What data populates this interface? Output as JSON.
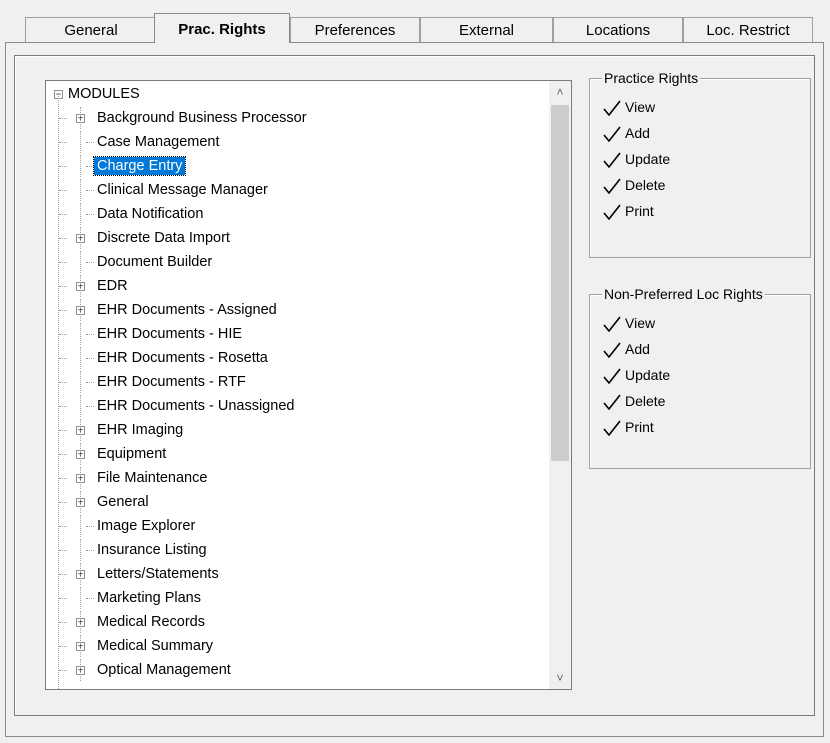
{
  "tabs": [
    {
      "label": "General",
      "active": false
    },
    {
      "label": "Prac. Rights",
      "active": true
    },
    {
      "label": "Preferences",
      "active": false
    },
    {
      "label": "External",
      "active": false
    },
    {
      "label": "Locations",
      "active": false
    },
    {
      "label": "Loc. Restrict",
      "active": false
    }
  ],
  "tree": {
    "root": "MODULES",
    "selected": "Charge Entry",
    "items": [
      {
        "label": "Background Business Processor",
        "expandable": true
      },
      {
        "label": "Case Management",
        "expandable": false
      },
      {
        "label": "Charge Entry",
        "expandable": false
      },
      {
        "label": "Clinical Message Manager",
        "expandable": false
      },
      {
        "label": "Data Notification",
        "expandable": false
      },
      {
        "label": "Discrete Data Import",
        "expandable": true
      },
      {
        "label": "Document Builder",
        "expandable": false
      },
      {
        "label": "EDR",
        "expandable": true
      },
      {
        "label": "EHR Documents - Assigned",
        "expandable": true
      },
      {
        "label": "EHR Documents - HIE",
        "expandable": false
      },
      {
        "label": "EHR Documents - Rosetta",
        "expandable": false
      },
      {
        "label": "EHR Documents - RTF",
        "expandable": false
      },
      {
        "label": "EHR Documents - Unassigned",
        "expandable": false
      },
      {
        "label": "EHR Imaging",
        "expandable": true
      },
      {
        "label": "Equipment",
        "expandable": true
      },
      {
        "label": "File Maintenance",
        "expandable": true
      },
      {
        "label": "General",
        "expandable": true
      },
      {
        "label": "Image Explorer",
        "expandable": false
      },
      {
        "label": "Insurance Listing",
        "expandable": false
      },
      {
        "label": "Letters/Statements",
        "expandable": true
      },
      {
        "label": "Marketing Plans",
        "expandable": false
      },
      {
        "label": "Medical Records",
        "expandable": true
      },
      {
        "label": "Medical Summary",
        "expandable": true
      },
      {
        "label": "Optical Management",
        "expandable": true
      }
    ]
  },
  "practice_rights": {
    "title": "Practice Rights",
    "items": [
      "View",
      "Add",
      "Update",
      "Delete",
      "Print"
    ]
  },
  "nonpreferred_rights": {
    "title": "Non-Preferred Loc Rights",
    "items": [
      "View",
      "Add",
      "Update",
      "Delete",
      "Print"
    ]
  },
  "colors": {
    "selection": "#0078d7",
    "scroll_thumb": "#cdcdcd"
  }
}
